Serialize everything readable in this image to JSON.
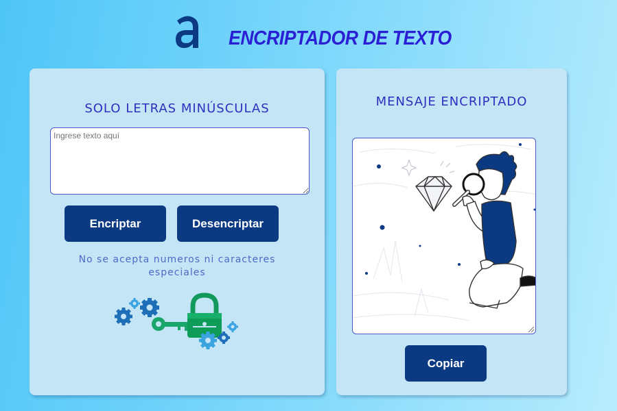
{
  "header": {
    "logo_letter": "a",
    "title": "ENCRIPTADOR DE TEXTO"
  },
  "encrypt_panel": {
    "heading": "SOLO LETRAS MINÚSCULAS",
    "input_placeholder": "Ingrese texto aquí",
    "encrypt_button": "Encriptar",
    "decrypt_button": "Desencriptar",
    "warning": "No se acepta numeros ni caracteres especiales",
    "illustration_icon": "lock-gears-key-illustration"
  },
  "result_panel": {
    "heading": "MENSAJE ENCRIPTADO",
    "illustration_icon": "person-with-magnifier-diamond-illustration",
    "copy_button": "Copiar"
  },
  "colors": {
    "title": "#2a1fd4",
    "heading": "#2e2fbf",
    "button": "#0b3a82",
    "card": "#c3e5f6",
    "logo": "#0b3a82"
  }
}
